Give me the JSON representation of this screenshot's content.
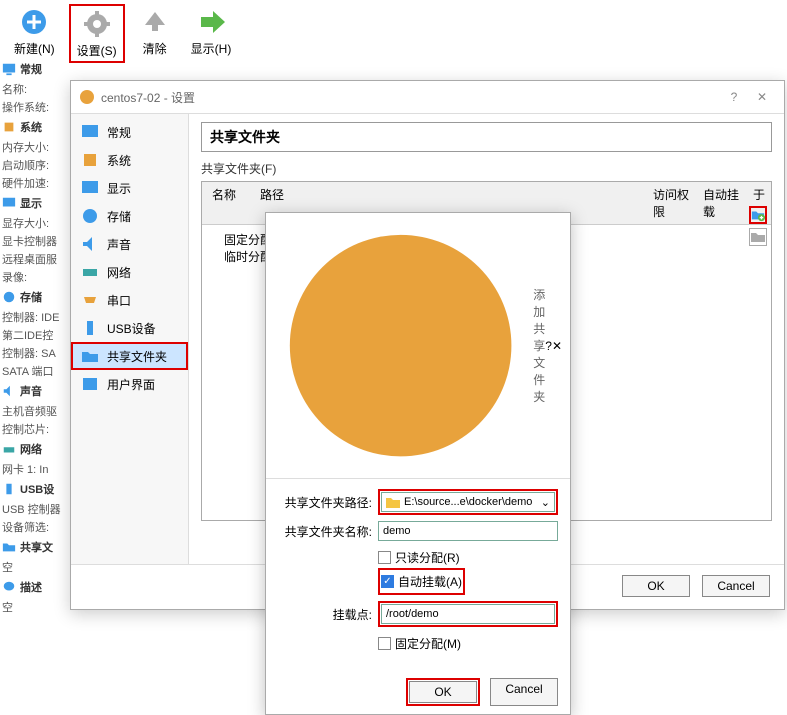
{
  "toolbar": {
    "new_label": "新建(N)",
    "settings_label": "设置(S)",
    "clear_label": "清除",
    "show_label": "显示(H)"
  },
  "left_panel": {
    "general": {
      "title": "常规",
      "name_label": "名称:",
      "os_label": "操作系统:"
    },
    "system": {
      "title": "系统",
      "mem_label": "内存大小:",
      "boot_label": "启动顺序:",
      "accel_label": "硬件加速:"
    },
    "display": {
      "title": "显示",
      "vmem_label": "显存大小:",
      "gpu_label": "显卡控制器",
      "remote_label": "远程桌面服",
      "record_label": "录像:"
    },
    "storage": {
      "title": "存储",
      "ctrl_label": "控制器: IDE",
      "ide2_label": "第二IDE控",
      "sata_label": "控制器: SA",
      "port_label": "SATA 端口"
    },
    "audio": {
      "title": "声音",
      "host_label": "主机音频驱",
      "chip_label": "控制芯片:"
    },
    "network": {
      "title": "网络",
      "nic_label": "网卡 1: In"
    },
    "usb": {
      "title": "USB设",
      "usb_ctrl_label": "USB 控制器",
      "dev_filter_label": "设备筛选:"
    },
    "shared": {
      "title": "共享文",
      "empty_label": "空"
    },
    "desc": {
      "title": "描述",
      "empty_label": "空"
    }
  },
  "settings_dialog": {
    "title": "centos7-02 - 设置",
    "categories": {
      "general": "常规",
      "system": "系统",
      "display": "显示",
      "storage": "存储",
      "audio": "声音",
      "network": "网络",
      "serial": "串口",
      "usb": "USB设备",
      "shared": "共享文件夹",
      "ui": "用户界面"
    },
    "content": {
      "heading": "共享文件夹",
      "fieldset_label": "共享文件夹(F)",
      "cols": {
        "name": "名称",
        "path": "路径",
        "perm": "访问权限",
        "mount": "自动挂载",
        "at": "于"
      },
      "row1": "固定分配",
      "row2": "临时分配"
    },
    "footer": {
      "ok": "OK",
      "cancel": "Cancel"
    }
  },
  "add_dialog": {
    "title": "添加共享文件夹",
    "path_label": "共享文件夹路径:",
    "path_value": "E:\\source...e\\docker\\demo",
    "name_label": "共享文件夹名称:",
    "name_value": "demo",
    "readonly_label": "只读分配(R)",
    "automount_label": "自动挂载(A)",
    "mountpoint_label": "挂载点:",
    "mountpoint_value": "/root/demo",
    "permanent_label": "固定分配(M)",
    "ok": "OK",
    "cancel": "Cancel"
  }
}
